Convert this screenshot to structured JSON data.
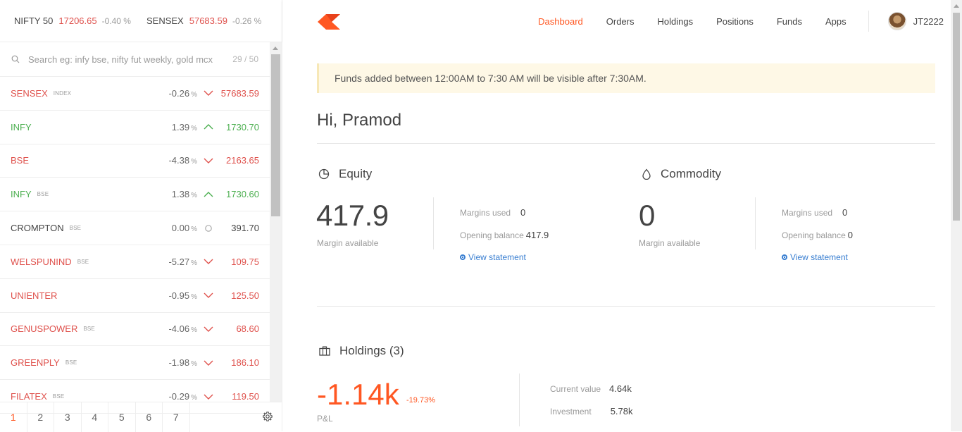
{
  "indices": [
    {
      "name": "NIFTY 50",
      "value": "17206.65",
      "change": "-0.40 %"
    },
    {
      "name": "SENSEX",
      "value": "57683.59",
      "change": "-0.26 %"
    }
  ],
  "nav": {
    "items": [
      "Dashboard",
      "Orders",
      "Holdings",
      "Positions",
      "Funds",
      "Apps"
    ],
    "active": "Dashboard",
    "user_id": "JT2222",
    "brand_color": "#ff5722"
  },
  "watchlist": {
    "search_placeholder": "Search eg: infy bse, nifty fut weekly, gold mcx",
    "count": "29 / 50",
    "items": [
      {
        "symbol": "SENSEX",
        "exchange": "INDEX",
        "change": "-0.26",
        "direction": "down",
        "price": "57683.59"
      },
      {
        "symbol": "INFY",
        "exchange": "",
        "change": "1.39",
        "direction": "up",
        "price": "1730.70"
      },
      {
        "symbol": "BSE",
        "exchange": "",
        "change": "-4.38",
        "direction": "down",
        "price": "2163.65"
      },
      {
        "symbol": "INFY",
        "exchange": "BSE",
        "change": "1.38",
        "direction": "up",
        "price": "1730.60"
      },
      {
        "symbol": "CROMPTON",
        "exchange": "BSE",
        "change": "0.00",
        "direction": "flat",
        "price": "391.70"
      },
      {
        "symbol": "WELSPUNIND",
        "exchange": "BSE",
        "change": "-5.27",
        "direction": "down",
        "price": "109.75"
      },
      {
        "symbol": "UNIENTER",
        "exchange": "",
        "change": "-0.95",
        "direction": "down",
        "price": "125.50"
      },
      {
        "symbol": "GENUSPOWER",
        "exchange": "BSE",
        "change": "-4.06",
        "direction": "down",
        "price": "68.60"
      },
      {
        "symbol": "GREENPLY",
        "exchange": "BSE",
        "change": "-1.98",
        "direction": "down",
        "price": "186.10"
      },
      {
        "symbol": "FILATEX",
        "exchange": "BSE",
        "change": "-0.29",
        "direction": "down",
        "price": "119.50"
      }
    ],
    "pct_unit": "%",
    "pages": [
      "1",
      "2",
      "3",
      "4",
      "5",
      "6",
      "7"
    ],
    "active_page": "1"
  },
  "dashboard": {
    "notice": "Funds added between 12:00AM to 7:30 AM will be visible after 7:30AM.",
    "greeting": "Hi, Pramod",
    "equity": {
      "title": "Equity",
      "margin_available": "417.9",
      "margin_available_label": "Margin available",
      "margins_used_label": "Margins used",
      "margins_used": "0",
      "opening_balance_label": "Opening balance",
      "opening_balance": "417.9",
      "view_statement": "View statement"
    },
    "commodity": {
      "title": "Commodity",
      "margin_available": "0",
      "margin_available_label": "Margin available",
      "margins_used_label": "Margins used",
      "margins_used": "0",
      "opening_balance_label": "Opening balance",
      "opening_balance": "0",
      "view_statement": "View statement"
    },
    "holdings": {
      "title": "Holdings (3)",
      "pnl": "-1.14k",
      "pnl_pct": "-19.73%",
      "pnl_label": "P&L",
      "current_value_label": "Current value",
      "current_value": "4.64k",
      "investment_label": "Investment",
      "investment": "5.78k"
    }
  },
  "colors": {
    "up": "#4caf50",
    "down": "#df514c",
    "accent": "#ff5722",
    "link": "#387ed1"
  }
}
